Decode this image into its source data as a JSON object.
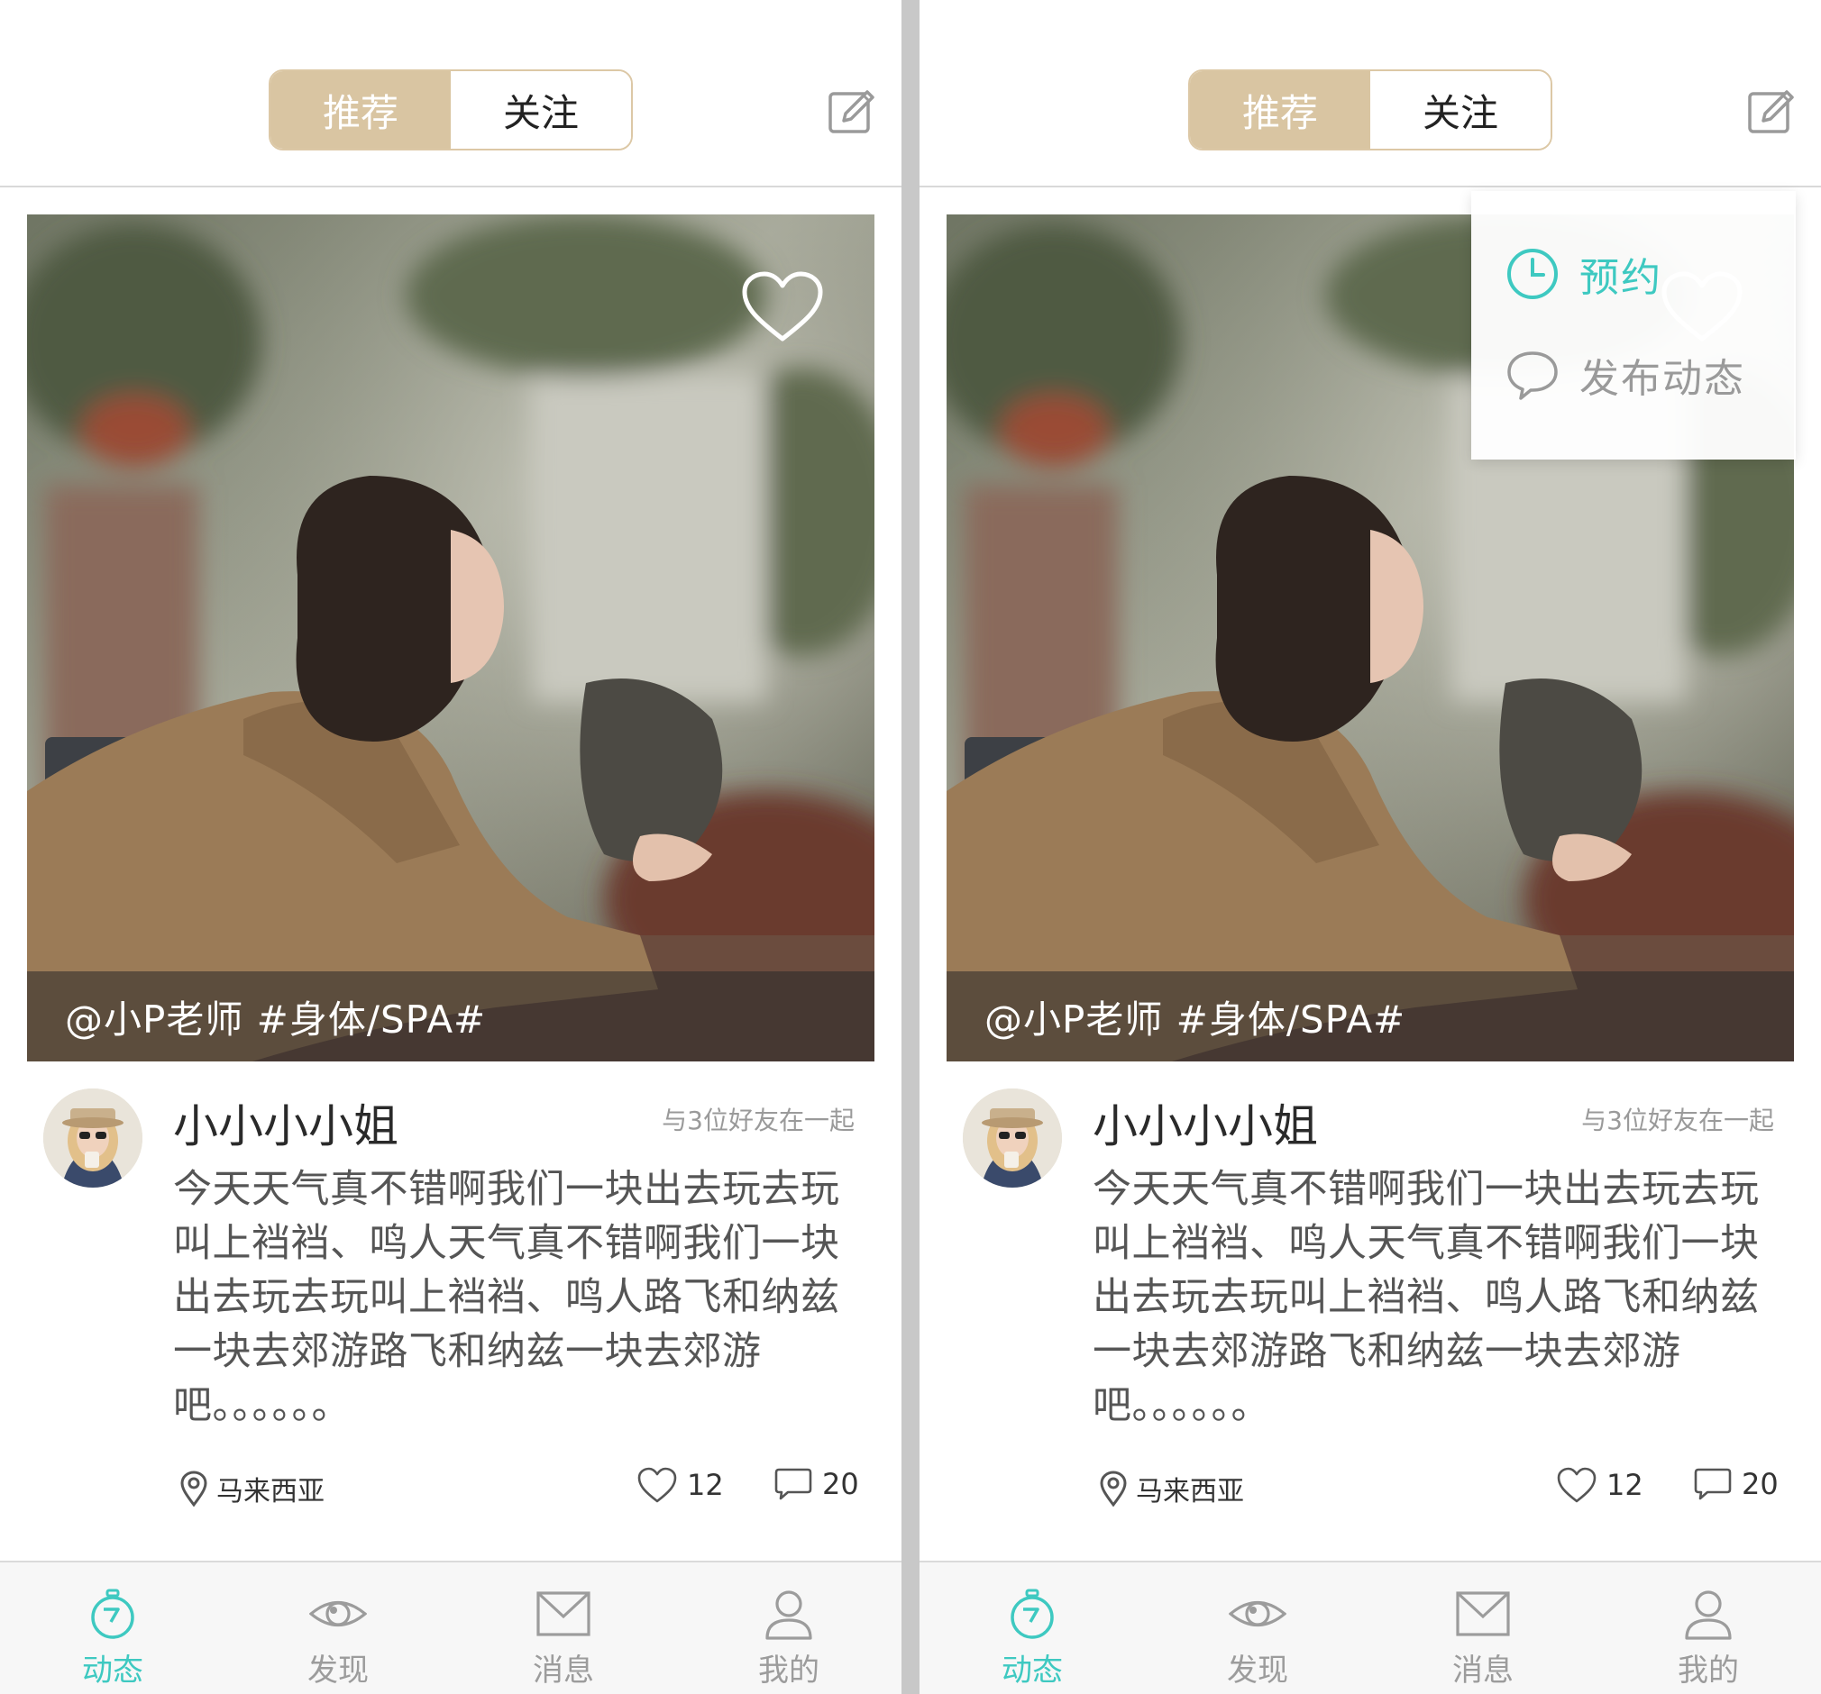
{
  "colors": {
    "accent_gold": "#d9c5a2",
    "accent_teal": "#3ec9c1",
    "text_gray": "#9a9a9a"
  },
  "screens": [
    {
      "header": {
        "tabs": [
          {
            "label": "推荐",
            "active": true
          },
          {
            "label": "关注",
            "active": false
          }
        ],
        "edit_icon": "edit-icon"
      },
      "post": {
        "caption": "@小P老师 #身体/SPA#",
        "username": "小小小小姐",
        "with_friends": "与3位好友在一起",
        "text": "今天天气真不错啊我们一块出去玩去玩叫上裆裆、鸣人天气真不错啊我们一块出去玩去玩叫上裆裆、鸣人路飞和纳兹一块去郊游路飞和纳兹一块去郊游吧。。。。。。",
        "location": "马来西亚",
        "likes": "12",
        "comments": "20"
      },
      "tabbar": [
        {
          "label": "动态",
          "icon": "stopwatch-icon",
          "active": true
        },
        {
          "label": "发现",
          "icon": "eye-icon",
          "active": false
        },
        {
          "label": "消息",
          "icon": "envelope-icon",
          "active": false
        },
        {
          "label": "我的",
          "icon": "person-icon",
          "active": false
        }
      ]
    },
    {
      "header": {
        "tabs": [
          {
            "label": "推荐",
            "active": true
          },
          {
            "label": "关注",
            "active": false
          }
        ],
        "edit_icon": "edit-icon"
      },
      "dropdown": {
        "items": [
          {
            "label": "预约",
            "icon": "clock-icon"
          },
          {
            "label": "发布动态",
            "icon": "speech-bubble-icon"
          }
        ]
      },
      "post": {
        "caption": "@小P老师 #身体/SPA#",
        "username": "小小小小姐",
        "with_friends": "与3位好友在一起",
        "text": "今天天气真不错啊我们一块出去玩去玩叫上裆裆、鸣人天气真不错啊我们一块出去玩去玩叫上裆裆、鸣人路飞和纳兹一块去郊游路飞和纳兹一块去郊游吧。。。。。。",
        "location": "马来西亚",
        "likes": "12",
        "comments": "20"
      },
      "tabbar": [
        {
          "label": "动态",
          "icon": "stopwatch-icon",
          "active": true
        },
        {
          "label": "发现",
          "icon": "eye-icon",
          "active": false
        },
        {
          "label": "消息",
          "icon": "envelope-icon",
          "active": false
        },
        {
          "label": "我的",
          "icon": "person-icon",
          "active": false
        }
      ]
    }
  ]
}
